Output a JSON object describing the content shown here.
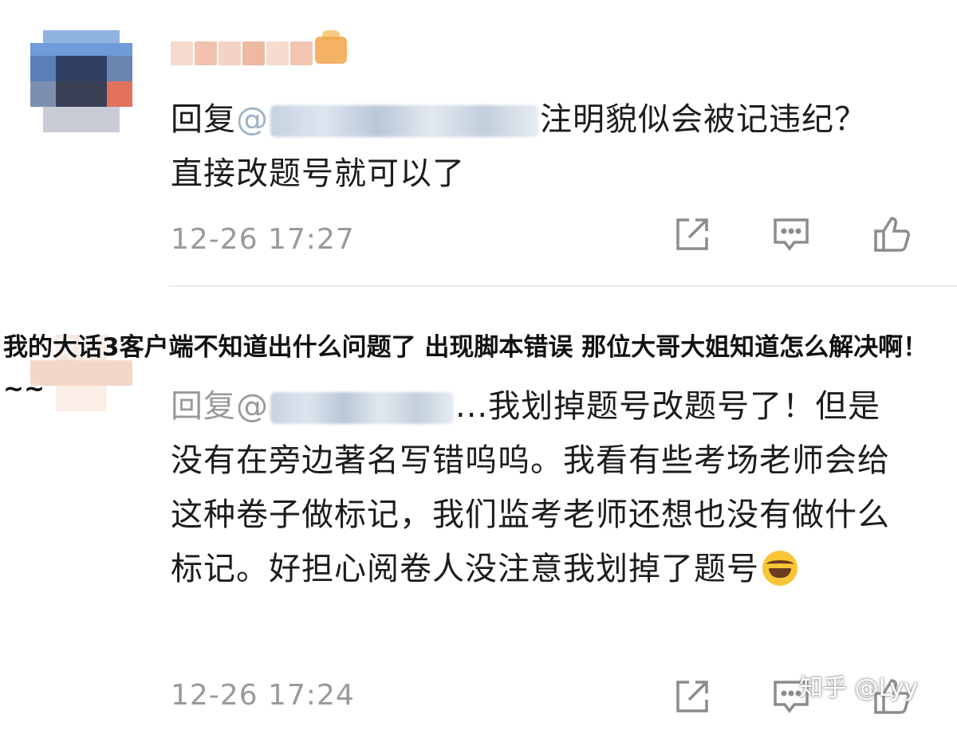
{
  "comments": [
    {
      "reply_prefix": "回复",
      "mention": "@",
      "text_line1": "注明貌似会被记违纪？",
      "text_line2": "直接改题号就可以了",
      "time": "12-26 17:27"
    },
    {
      "reply_prefix": "回复",
      "mention": "@",
      "text_rest": "...我划掉题号改题号了！但是没有在旁边著名写错呜呜。我看有些考场老师会给这种卷子做标记，我们监考老师还想也没有做什么标记。好担心阅卷人没注意我划掉了题号",
      "emoji": "laughing-crying",
      "time": "12-26 17:24"
    }
  ],
  "actions": {
    "share_icon": "share-edit-icon",
    "reply_icon": "comment-icon",
    "like_icon": "thumbs-up-icon"
  },
  "overlay_title": "我的大话3客户端不知道出什么问题了 出现脚本错误 那位大哥大姐知道怎么解决啊！~~",
  "watermark": "知乎 @Lyy"
}
